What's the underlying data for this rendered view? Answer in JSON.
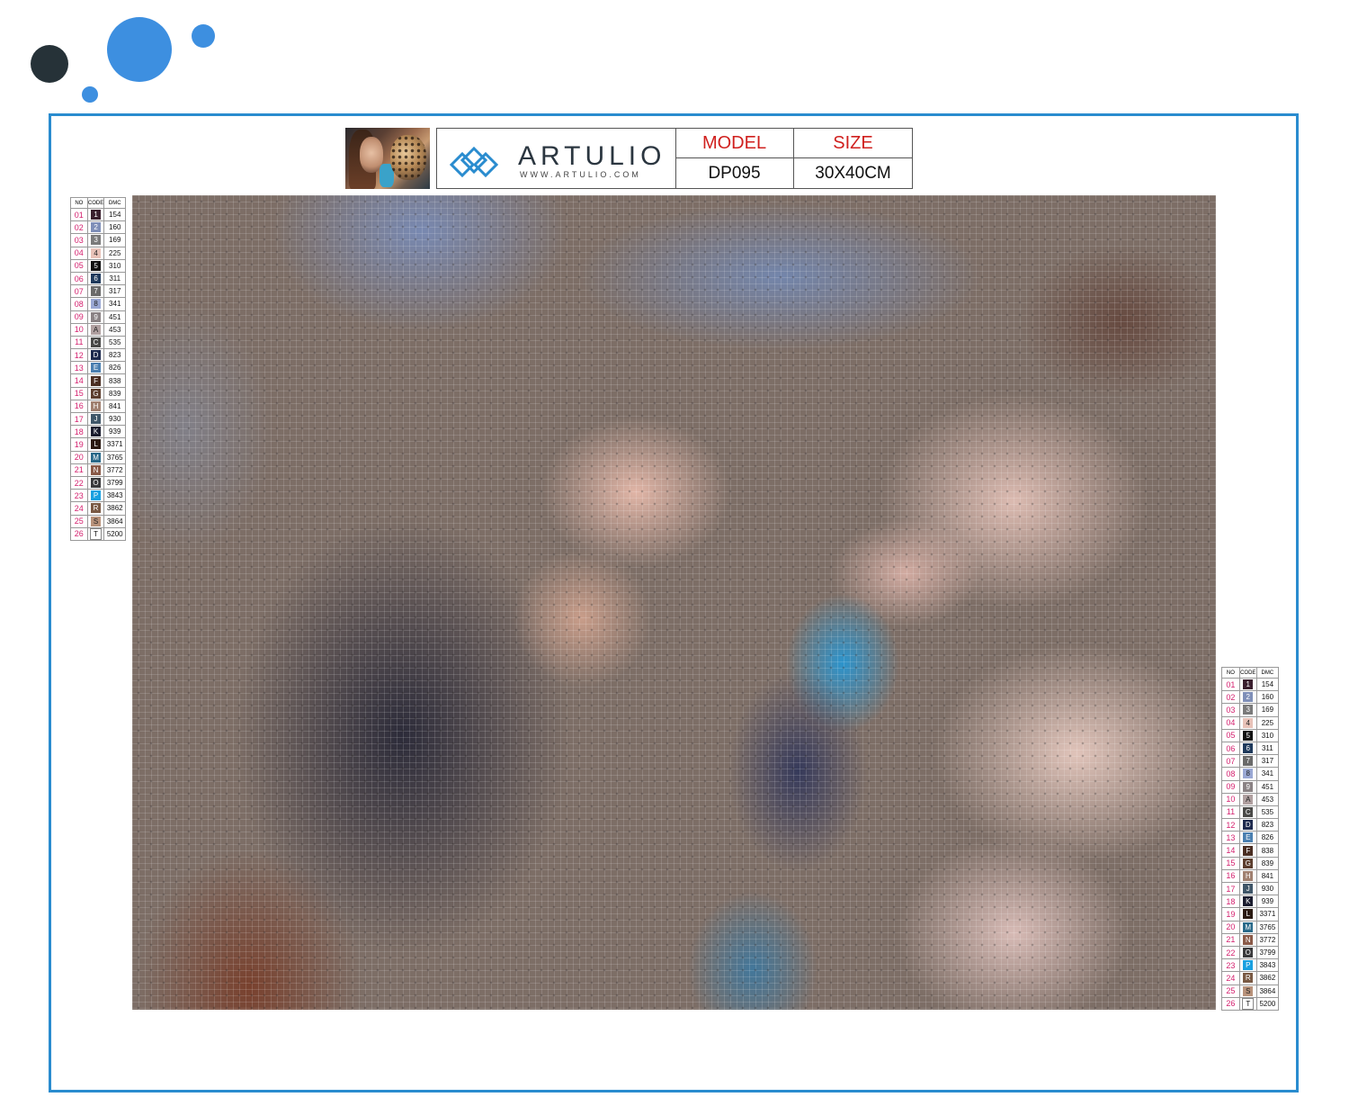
{
  "colors": {
    "dot_dark": "#263238",
    "dot_blue": "#3d8fe0",
    "frame": "#2a8ccf",
    "label_red": "#d0201e",
    "legend_no": "#d4206e"
  },
  "header": {
    "brand": "ARTULIO",
    "url": "WWW.ARTULIO.COM",
    "model_label": "MODEL",
    "model_value": "DP095",
    "size_label": "SIZE",
    "size_value": "30X40CM"
  },
  "legend": {
    "headers": [
      "NO",
      "CODE",
      "DMC"
    ],
    "rows": [
      {
        "no": "01",
        "code": "1",
        "dmc": "154",
        "color": "#3a1f2e"
      },
      {
        "no": "02",
        "code": "2",
        "dmc": "160",
        "color": "#7f8fb8"
      },
      {
        "no": "03",
        "code": "3",
        "dmc": "169",
        "color": "#7a7a7a"
      },
      {
        "no": "04",
        "code": "4",
        "dmc": "225",
        "color": "#e8c2b8"
      },
      {
        "no": "05",
        "code": "5",
        "dmc": "310",
        "color": "#111111"
      },
      {
        "no": "06",
        "code": "6",
        "dmc": "311",
        "color": "#1f3a5c"
      },
      {
        "no": "07",
        "code": "7",
        "dmc": "317",
        "color": "#6a6a6a"
      },
      {
        "no": "08",
        "code": "8",
        "dmc": "341",
        "color": "#9aa8d4"
      },
      {
        "no": "09",
        "code": "9",
        "dmc": "451",
        "color": "#8a8284"
      },
      {
        "no": "10",
        "code": "A",
        "dmc": "453",
        "color": "#b0a0a0"
      },
      {
        "no": "11",
        "code": "C",
        "dmc": "535",
        "color": "#4a4a48"
      },
      {
        "no": "12",
        "code": "D",
        "dmc": "823",
        "color": "#1d2a4e"
      },
      {
        "no": "13",
        "code": "E",
        "dmc": "826",
        "color": "#4a7fb0"
      },
      {
        "no": "14",
        "code": "F",
        "dmc": "838",
        "color": "#4a2e22"
      },
      {
        "no": "15",
        "code": "G",
        "dmc": "839",
        "color": "#5c3e2e"
      },
      {
        "no": "16",
        "code": "H",
        "dmc": "841",
        "color": "#a08070"
      },
      {
        "no": "17",
        "code": "J",
        "dmc": "930",
        "color": "#3f5668"
      },
      {
        "no": "18",
        "code": "K",
        "dmc": "939",
        "color": "#1a1c2e"
      },
      {
        "no": "19",
        "code": "L",
        "dmc": "3371",
        "color": "#2a1a12"
      },
      {
        "no": "20",
        "code": "M",
        "dmc": "3765",
        "color": "#2a6a8a"
      },
      {
        "no": "21",
        "code": "N",
        "dmc": "3772",
        "color": "#8a5a48"
      },
      {
        "no": "22",
        "code": "O",
        "dmc": "3799",
        "color": "#3a3a3c"
      },
      {
        "no": "23",
        "code": "P",
        "dmc": "3843",
        "color": "#1aa0e0"
      },
      {
        "no": "24",
        "code": "R",
        "dmc": "3862",
        "color": "#7a5a44"
      },
      {
        "no": "25",
        "code": "S",
        "dmc": "3864",
        "color": "#b8927a"
      },
      {
        "no": "26",
        "code": "T",
        "dmc": "5200",
        "color": "#ffffff"
      }
    ]
  }
}
